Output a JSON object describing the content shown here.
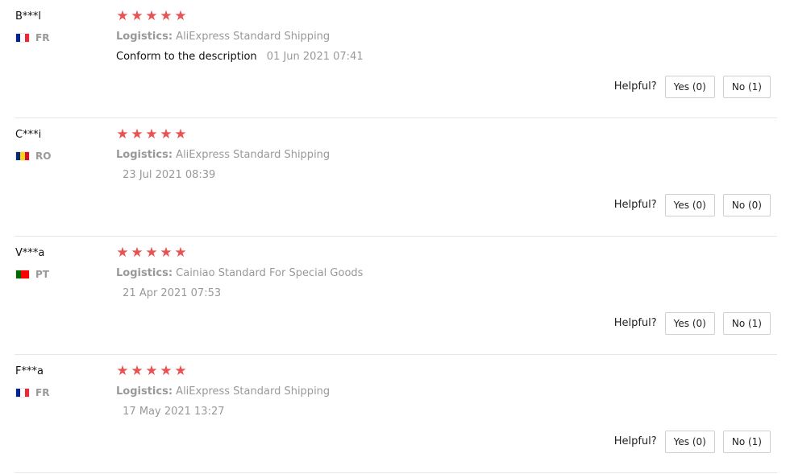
{
  "reviews": [
    {
      "user": "B***l",
      "country": "FR",
      "flag_colors": [
        "#002395",
        "#ffffff",
        "#ed2939"
      ],
      "rating": 5,
      "logistics_label": "Logistics:",
      "logistics_value": "AliExpress Standard Shipping",
      "feedback": "Conform to the description",
      "date": "01 Jun 2021 07:41",
      "helpful_label": "Helpful?",
      "yes_label": "Yes (0)",
      "no_label": "No (1)"
    },
    {
      "user": "C***i",
      "country": "RO",
      "flag_colors": [
        "#002b7f",
        "#fcd116",
        "#ce1126"
      ],
      "rating": 5,
      "logistics_label": "Logistics:",
      "logistics_value": "AliExpress Standard Shipping",
      "feedback": "",
      "date": "23 Jul 2021 08:39",
      "helpful_label": "Helpful?",
      "yes_label": "Yes (0)",
      "no_label": "No (0)"
    },
    {
      "user": "V***a",
      "country": "PT",
      "flag_colors": [
        "#006600",
        "#ff0000"
      ],
      "rating": 5,
      "logistics_label": "Logistics:",
      "logistics_value": "Cainiao Standard For Special Goods",
      "feedback": "",
      "date": "21 Apr 2021 07:53",
      "helpful_label": "Helpful?",
      "yes_label": "Yes (0)",
      "no_label": "No (1)"
    },
    {
      "user": "F***a",
      "country": "FR",
      "flag_colors": [
        "#002395",
        "#ffffff",
        "#ed2939"
      ],
      "rating": 5,
      "logistics_label": "Logistics:",
      "logistics_value": "AliExpress Standard Shipping",
      "feedback": "",
      "date": "17 May 2021 13:27",
      "helpful_label": "Helpful?",
      "yes_label": "Yes (0)",
      "no_label": "No (1)"
    }
  ],
  "star_glyph": "★",
  "star_color": "#e95252"
}
